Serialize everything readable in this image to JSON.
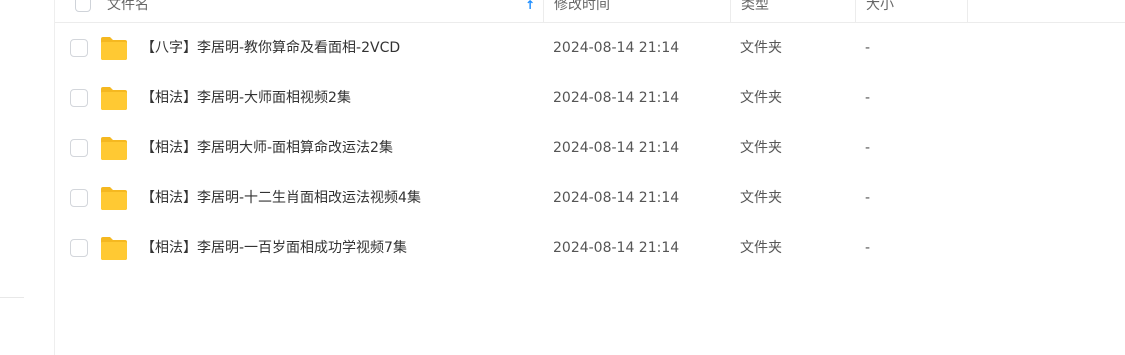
{
  "header": {
    "name_label": "文件名",
    "time_label": "修改时间",
    "type_label": "类型",
    "size_label": "大小",
    "sort_icon": "sort-ascending-arrow-icon"
  },
  "files": [
    {
      "name": "【八字】李居明-教你算命及看面相-2VCD",
      "modified": "2024-08-14 21:14",
      "type": "文件夹",
      "size": "-"
    },
    {
      "name": "【相法】李居明-大师面相视频2集",
      "modified": "2024-08-14 21:14",
      "type": "文件夹",
      "size": "-"
    },
    {
      "name": "【相法】李居明大师-面相算命改运法2集",
      "modified": "2024-08-14 21:14",
      "type": "文件夹",
      "size": "-"
    },
    {
      "name": "【相法】李居明-十二生肖面相改运法视频4集",
      "modified": "2024-08-14 21:14",
      "type": "文件夹",
      "size": "-"
    },
    {
      "name": "【相法】李居明-一百岁面相成功学视频7集",
      "modified": "2024-08-14 21:14",
      "type": "文件夹",
      "size": "-"
    }
  ],
  "colors": {
    "folder_yellow": "#FFC933",
    "accent_blue": "#1A8CFF"
  }
}
